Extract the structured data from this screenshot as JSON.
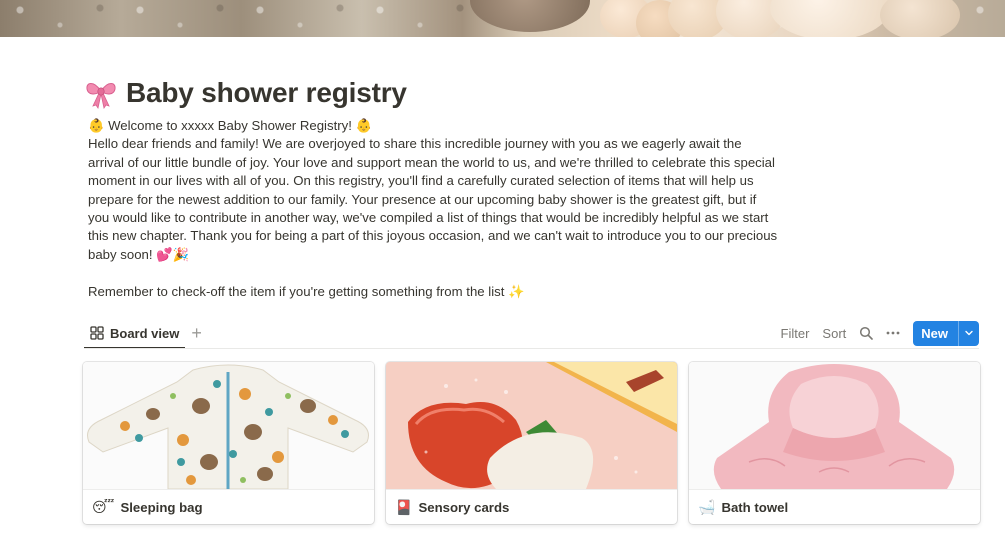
{
  "page": {
    "title": "Baby shower registry",
    "title_icon": "ribbon-bow-icon",
    "welcome_line": "👶 Welcome to xxxxx  Baby Shower Registry! 👶",
    "intro_paragraph": "Hello dear friends and family! We are overjoyed to share this incredible journey with you as we eagerly await the arrival of our little bundle of joy. Your love and support mean the world to us, and we're thrilled to celebrate this special moment in our lives with all of you. On this registry, you'll find a carefully curated selection of items that will help us prepare for the newest addition to our family. Your presence at our upcoming baby shower is the greatest gift, but if you would like to contribute in another way, we've compiled a list of things that would be incredibly helpful as we start this new chapter. Thank you for being a part of this joyous occasion, and we can't wait to introduce you to our precious baby soon! 💕🎉",
    "reminder": "Remember to check-off the item if you're getting something from the list ✨"
  },
  "toolbar": {
    "view_tab_label": "Board view",
    "view_tab_icon": "board-grid-icon",
    "add_view_icon": "plus-icon",
    "filter_label": "Filter",
    "sort_label": "Sort",
    "search_icon": "search-icon",
    "more_icon": "more-dots-icon",
    "new_label": "New",
    "new_dropdown_icon": "chevron-down-icon",
    "accent_color": "#2383e2"
  },
  "cards": [
    {
      "emoji": "😴",
      "title": "Sleeping bag",
      "image": "sleeping-bag-image"
    },
    {
      "emoji": "🎴",
      "title": "Sensory cards",
      "image": "sensory-cards-image"
    },
    {
      "emoji": "🛁",
      "title": "Bath towel",
      "image": "bath-towel-image"
    }
  ]
}
